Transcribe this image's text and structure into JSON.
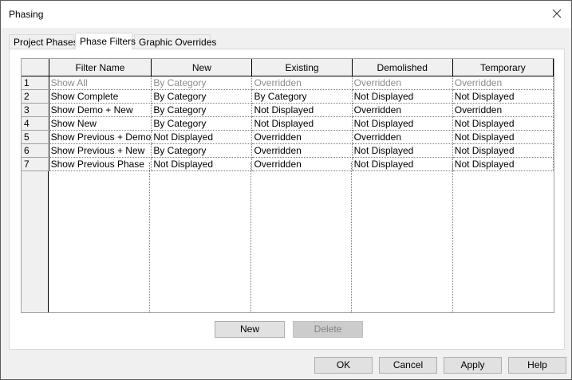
{
  "window": {
    "title": "Phasing"
  },
  "tabs": [
    {
      "label": "Project Phases",
      "active": false
    },
    {
      "label": "Phase Filters",
      "active": true
    },
    {
      "label": "Graphic Overrides",
      "active": false
    }
  ],
  "grid": {
    "columns": [
      "Filter Name",
      "New",
      "Existing",
      "Demolished",
      "Temporary"
    ],
    "rows": [
      {
        "num": "1",
        "name": "Show All",
        "new": "By Category",
        "existing": "Overridden",
        "demolished": "Overridden",
        "temporary": "Overridden",
        "dimmed": true
      },
      {
        "num": "2",
        "name": "Show Complete",
        "new": "By Category",
        "existing": "By Category",
        "demolished": "Not Displayed",
        "temporary": "Not Displayed"
      },
      {
        "num": "3",
        "name": "Show Demo + New",
        "new": "By Category",
        "existing": "Not Displayed",
        "demolished": "Overridden",
        "temporary": "Overridden"
      },
      {
        "num": "4",
        "name": "Show New",
        "new": "By Category",
        "existing": "Not Displayed",
        "demolished": "Not Displayed",
        "temporary": "Not Displayed"
      },
      {
        "num": "5",
        "name": "Show Previous + Demo",
        "new": "Not Displayed",
        "existing": "Overridden",
        "demolished": "Overridden",
        "temporary": "Not Displayed"
      },
      {
        "num": "6",
        "name": "Show Previous + New",
        "new": "By Category",
        "existing": "Overridden",
        "demolished": "Not Displayed",
        "temporary": "Not Displayed"
      },
      {
        "num": "7",
        "name": "Show Previous Phase",
        "new": "Not Displayed",
        "existing": "Overridden",
        "demolished": "Not Displayed",
        "temporary": "Not Displayed"
      }
    ]
  },
  "buttons": {
    "new": "New",
    "delete": "Delete",
    "ok": "OK",
    "cancel": "Cancel",
    "apply": "Apply",
    "help": "Help"
  },
  "icons": {
    "close": "close-icon"
  },
  "colors": {
    "dimmed_text": "#8c8c8c",
    "disabled_button": "#cccccc"
  }
}
